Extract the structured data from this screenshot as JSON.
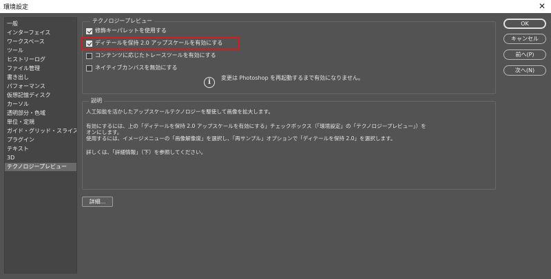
{
  "window": {
    "title": "環境設定",
    "close_glyph": "✕"
  },
  "sidebar": {
    "items": [
      {
        "label": "一般"
      },
      {
        "label": "インターフェイス"
      },
      {
        "label": "ワークスペース"
      },
      {
        "label": "ツール"
      },
      {
        "label": "ヒストリーログ"
      },
      {
        "label": "ファイル管理"
      },
      {
        "label": "書き出し"
      },
      {
        "label": "パフォーマンス"
      },
      {
        "label": "仮想記憶ディスク"
      },
      {
        "label": "カーソル"
      },
      {
        "label": "透明部分・色域"
      },
      {
        "label": "単位・定規"
      },
      {
        "label": "ガイド・グリッド・スライス"
      },
      {
        "label": "プラグイン"
      },
      {
        "label": "テキスト"
      },
      {
        "label": "3D"
      },
      {
        "label": "テクノロジープレビュー"
      }
    ],
    "selected_index": 16
  },
  "tech_preview": {
    "group_label": "テクノロジープレビュー",
    "options": [
      {
        "label": "修飾キーパレットを使用する",
        "checked": true
      },
      {
        "label": "ディテールを保持 2.0 アップスケールを有効にする",
        "checked": true
      },
      {
        "label": "コンテンツに応じたトレースツールを有効にする",
        "checked": false
      },
      {
        "label": "ネイティブカンバスを無効にする",
        "checked": false
      }
    ],
    "info_icon": "i",
    "info_text": "変更は Photoshop を再起動するまで有効になりません。"
  },
  "description": {
    "group_label": "説明",
    "lines": [
      "人工知能を活かしたアップスケールテクノロジーを駆使して画像を拡大します。",
      "有効にするには、上の「ディテールを保持 2.0 アップスケールを有効にする」チェックボックス（「環境設定」の「テクノロジープレビュー」）を",
      "オンにします。",
      "使用するには、イメージメニューの「画像解像度」を選択し、「再サンプル」オプションで「ディテールを保持 2.0」を選択します。",
      "詳しくは、「詳細情報」（下）を参照してください。"
    ]
  },
  "buttons": {
    "ok": "OK",
    "cancel": "キャンセル",
    "prev": "前へ(P)",
    "next": "次へ(N)",
    "details": "詳細..."
  },
  "colors": {
    "highlight": "#d81b1b",
    "background": "#535353",
    "selected_item": "#6a6a6a"
  }
}
